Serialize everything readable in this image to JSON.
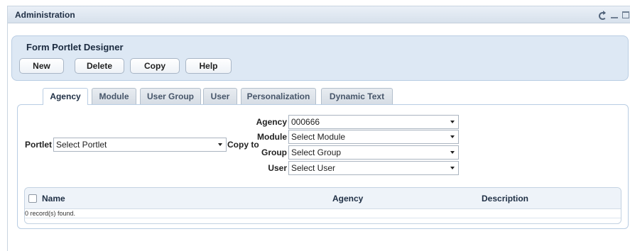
{
  "window": {
    "title": "Administration",
    "controls": [
      "refresh-icon",
      "minimize-icon",
      "maximize-icon"
    ]
  },
  "designer": {
    "heading": "Form Portlet Designer",
    "buttons": {
      "new": "New",
      "delete": "Delete",
      "copy": "Copy",
      "help": "Help"
    }
  },
  "tabs": [
    {
      "label": "Agency",
      "active": true
    },
    {
      "label": "Module",
      "active": false
    },
    {
      "label": "User Group",
      "active": false
    },
    {
      "label": "User",
      "active": false
    },
    {
      "label": "Personalization",
      "active": false
    },
    {
      "label": "Dynamic Text",
      "active": false
    }
  ],
  "form": {
    "portlet_label": "Portlet",
    "portlet_value": "Select Portlet",
    "copy_to_label": "Copy to",
    "agency_label": "Agency",
    "agency_value": "000666",
    "module_label": "Module",
    "module_value": "Select Module",
    "group_label": "Group",
    "group_value": "Select Group",
    "user_label": "User",
    "user_value": "Select User"
  },
  "grid": {
    "columns": [
      "Name",
      "Agency",
      "Description"
    ],
    "records_text": "0 record(s) found."
  },
  "colors": {
    "panel_bg": "#dde8f4",
    "border": "#b9cde3",
    "title_text": "#1f2f45"
  }
}
